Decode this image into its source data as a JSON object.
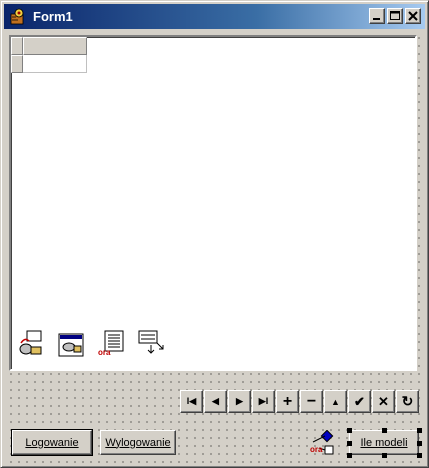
{
  "window": {
    "title": "Form1"
  },
  "buttons": {
    "login_label": "Logowanie",
    "logout_label": "Wylogowanie",
    "count_label": "Ile modeli"
  },
  "components": [
    {
      "icon": "session-component-icon"
    },
    {
      "icon": "dataset-component-icon"
    },
    {
      "icon": "table-component-icon"
    },
    {
      "icon": "query-component-icon"
    }
  ],
  "navigator": [
    {
      "icon": "first-record-icon",
      "glyph": "I◀"
    },
    {
      "icon": "prior-record-icon",
      "glyph": "◀"
    },
    {
      "icon": "next-record-icon",
      "glyph": "▶"
    },
    {
      "icon": "last-record-icon",
      "glyph": "▶I"
    },
    {
      "icon": "insert-record-icon",
      "glyph": "+"
    },
    {
      "icon": "delete-record-icon",
      "glyph": "−"
    },
    {
      "icon": "edit-record-icon",
      "glyph": "▲"
    },
    {
      "icon": "post-record-icon",
      "glyph": "✔"
    },
    {
      "icon": "cancel-record-icon",
      "glyph": "✕"
    },
    {
      "icon": "refresh-record-icon",
      "glyph": "↻"
    }
  ]
}
